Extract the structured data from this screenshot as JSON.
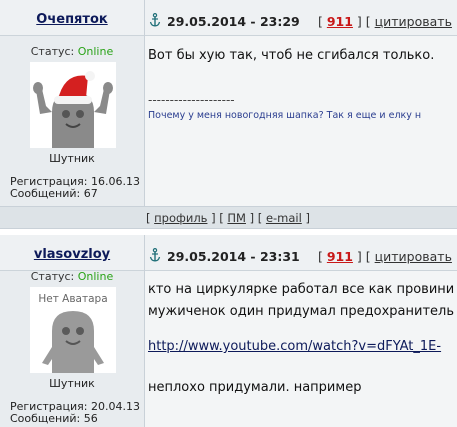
{
  "posts": [
    {
      "author": "Очепяток",
      "date": "29.05.2014 - 23:29",
      "post_number": "911",
      "quote_label": "цитировать",
      "status_label": "Статус: ",
      "status_value": "Online",
      "rank": "Шутник",
      "registration": "Регистрация: 16.06.13",
      "messages": "Сообщений: 67",
      "text_lines": [
        "Вот бы хую так, чтоб не сгибался только."
      ],
      "signature_divider": "--------------------",
      "signature": "Почему у меня новогодняя шапка? Так я еще и елку н"
    },
    {
      "author": "vlasovzloy",
      "date": "29.05.2014 - 23:31",
      "post_number": "911",
      "quote_label": "цитировать",
      "status_label": "Статус: ",
      "status_value": "Online",
      "avatar_caption": "Нет Аватара",
      "rank": "Шутник",
      "registration": "Регистрация: 20.04.13",
      "messages": "Сообщений: 56",
      "text_lines": [
        "кто на циркулярке работал все как провини",
        "мужиченок один придумал предохранитель д"
      ],
      "link": "http://www.youtube.com/watch?v=dFYAt_1E-",
      "text_after": "неплохо придумали. например"
    }
  ],
  "footer": {
    "profile_label": "профиль",
    "pm_label": "ПМ",
    "email_label": "e-mail"
  },
  "colors": {
    "online": "#2aa318",
    "post_number": "#c81818",
    "author": "#0d1a5a"
  }
}
